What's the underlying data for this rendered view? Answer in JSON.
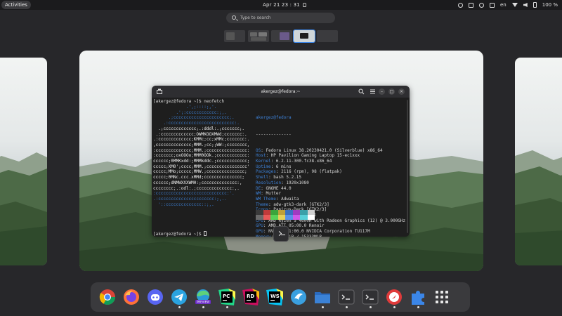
{
  "topbar": {
    "activities_label": "Activities",
    "clock": "Apr 21  23 : 31",
    "tray": {
      "language": "en",
      "battery": "100 %"
    }
  },
  "search": {
    "placeholder": "Type to search"
  },
  "terminal": {
    "title": "akergez@fedora:~",
    "prompt_first": "[akergez@fedora ~]$ neofetch",
    "prompt_last": "[akergez@fedora ~]$ ",
    "ascii": [
      "             .',;::::;,'.",
      "         .';:cccccccccccc:;,.",
      "      .;cccccccccccccccccccccc;.",
      "    .:cccccccccccccccccccccccccc:.",
      "  .;ccccccccccccc;.:dddl:.;ccccccc;.",
      " .:ccccccccccccc;OWMKOOXMWd;ccccccc:.",
      ".:ccccccccccccc;KMMc;cc;xMMc;ccccccc:.",
      ",cccccccccccccc;MMM.;cc;;WW:;cccccccc,",
      ":cccccccccccccc;MMM.;cccccccccccccccc:",
      ":ccccccc;oxOOOo;MMM0OOk.;cccccccccccc:",
      "cccccc;0MMKxdd:;MMMkddc.;cccccccccccc;",
      "ccccc;XM0';cccc;MMM.;cccccccccccccccc'",
      "ccccc;MMo;ccccc;MMW.;ccccccccccccccc;",
      "ccccc;0MNc.ccc.xMMd;ccccccccccccccc;",
      "cccccc;dNMWXXXWM0:;cccccccccccccc:,",
      "cccccccc;.:odl:.;cccccccccccccc:,.",
      ":cccccccccccccccccccccccccccc:'.",
      ".:cccccccccccccccccccccc:;,..",
      "  '::cccccccccccccc::;,."
    ],
    "user_host": "akergez@fedora",
    "separator": "--------------",
    "info": [
      {
        "key": "OS",
        "value": "Fedora Linux 38.20230421.0 (Silverblue) x86_64"
      },
      {
        "key": "Host",
        "value": "HP Pavilion Gaming Laptop 15-ec1xxx"
      },
      {
        "key": "Kernel",
        "value": "6.2.11-300.fc38.x86_64"
      },
      {
        "key": "Uptime",
        "value": "6 mins"
      },
      {
        "key": "Packages",
        "value": "2116 (rpm), 98 (flatpak)"
      },
      {
        "key": "Shell",
        "value": "bash 5.2.15"
      },
      {
        "key": "Resolution",
        "value": "1920x1080"
      },
      {
        "key": "DE",
        "value": "GNOME 44.0"
      },
      {
        "key": "WM",
        "value": "Mutter"
      },
      {
        "key": "WM Theme",
        "value": "Adwaita"
      },
      {
        "key": "Theme",
        "value": "adw-gtk3-dark [GTK2/3]"
      },
      {
        "key": "Icons",
        "value": "Papirus-Dark [GTK2/3]"
      },
      {
        "key": "Terminal",
        "value": "gnome-terminal"
      },
      {
        "key": "CPU",
        "value": "AMD Ryzen 5 4600H with Radeon Graphics (12) @ 3.000GHz"
      },
      {
        "key": "GPU",
        "value": "AMD ATI 05:00.0 Renoir"
      },
      {
        "key": "GPU",
        "value": "NVIDIA 01:00.0 NVIDIA Corporation TU117M"
      },
      {
        "key": "Memory",
        "value": "5035MiB / 15333MiB"
      }
    ],
    "swatches_row1": [
      "#3a3a3a",
      "#c03a3a",
      "#3ba43b",
      "#c0a03a",
      "#3a6fc0",
      "#a03ac0",
      "#3aa0a8",
      "#d0d0d0"
    ],
    "swatches_row2": [
      "#6a6a6a",
      "#e85858",
      "#58d058",
      "#e8d058",
      "#5890e8",
      "#d058e8",
      "#58d0d8",
      "#ffffff"
    ]
  },
  "dock": {
    "apps": [
      {
        "name": "chrome-icon",
        "color": "#db4437"
      },
      {
        "name": "firefox-icon",
        "color": "#ff7139"
      },
      {
        "name": "discord-icon",
        "color": "#5865f2"
      },
      {
        "name": "telegram-icon",
        "color": "#2aa3e0"
      },
      {
        "name": "edge-preview-icon",
        "color": "#2b9bd8",
        "badge": "PREVIEW"
      },
      {
        "name": "pycharm-icon",
        "color": "#21d789",
        "label": "PC"
      },
      {
        "name": "rider-icon",
        "color": "#c90f5e",
        "label": "RD"
      },
      {
        "name": "webstorm-icon",
        "color": "#07c3f2",
        "label": "WS"
      },
      {
        "name": "fluent-reader-icon",
        "color": "#3aa0e0"
      },
      {
        "name": "files-icon",
        "color": "#3b82d6"
      },
      {
        "name": "terminal-icon",
        "color": "#303033"
      },
      {
        "name": "terminal2-icon",
        "color": "#303033"
      },
      {
        "name": "todo-icon",
        "color": "#e03b3b"
      },
      {
        "name": "extensions-icon",
        "color": "#3b86e8"
      },
      {
        "name": "app-grid-icon",
        "color": "#e8e8e8"
      }
    ]
  }
}
